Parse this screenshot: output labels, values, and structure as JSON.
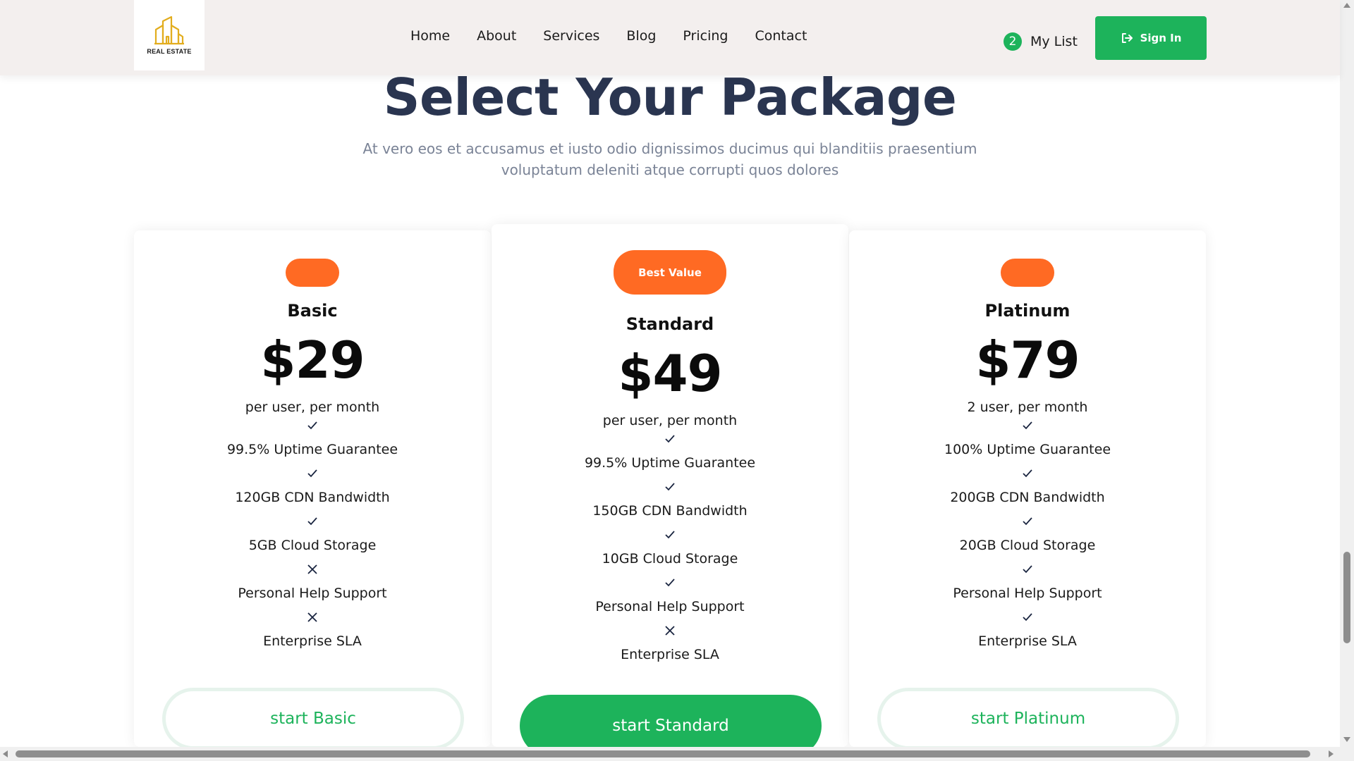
{
  "header": {
    "logo_text": "REAL ESTATE",
    "nav": [
      "Home",
      "About",
      "Services",
      "Blog",
      "Pricing",
      "Contact"
    ],
    "mylist_count": "2",
    "mylist_label": "My List",
    "signin_label": "Sign In"
  },
  "section": {
    "title": "Select Your Package",
    "subtitle": "At vero eos et accusamus et iusto odio dignissimos ducimus qui blanditiis praesentium voluptatum deleniti atque corrupti quos dolores"
  },
  "plans": [
    {
      "tag": "",
      "name": "Basic",
      "price": "$29",
      "period": "per user, per month",
      "features": [
        {
          "text": "99.5% Uptime Guarantee",
          "included": true
        },
        {
          "text": "120GB CDN Bandwidth",
          "included": true
        },
        {
          "text": "5GB Cloud Storage",
          "included": true
        },
        {
          "text": "Personal Help Support",
          "included": false
        },
        {
          "text": "Enterprise SLA",
          "included": false
        }
      ],
      "button": "start Basic",
      "featured": false
    },
    {
      "tag": "Best Value",
      "name": "Standard",
      "price": "$49",
      "period": "per user, per month",
      "features": [
        {
          "text": "99.5% Uptime Guarantee",
          "included": true
        },
        {
          "text": "150GB CDN Bandwidth",
          "included": true
        },
        {
          "text": "10GB Cloud Storage",
          "included": true
        },
        {
          "text": "Personal Help Support",
          "included": true
        },
        {
          "text": "Enterprise SLA",
          "included": false
        }
      ],
      "button": "start Standard",
      "featured": true
    },
    {
      "tag": "",
      "name": "Platinum",
      "price": "$79",
      "period": "2 user, per month",
      "features": [
        {
          "text": "100% Uptime Guarantee",
          "included": true
        },
        {
          "text": "200GB CDN Bandwidth",
          "included": true
        },
        {
          "text": "20GB Cloud Storage",
          "included": true
        },
        {
          "text": "Personal Help Support",
          "included": true
        },
        {
          "text": "Enterprise SLA",
          "included": true
        }
      ],
      "button": "start Platinum",
      "featured": false
    }
  ],
  "colors": {
    "accent_green": "#1db35b",
    "tag_orange": "#ff6a23",
    "title": "#2a3550",
    "header_bg": "#f3efee"
  },
  "icons": {
    "included": "check-icon",
    "excluded": "x-icon",
    "signin": "sign-in-icon",
    "logo": "building-logo-icon"
  }
}
